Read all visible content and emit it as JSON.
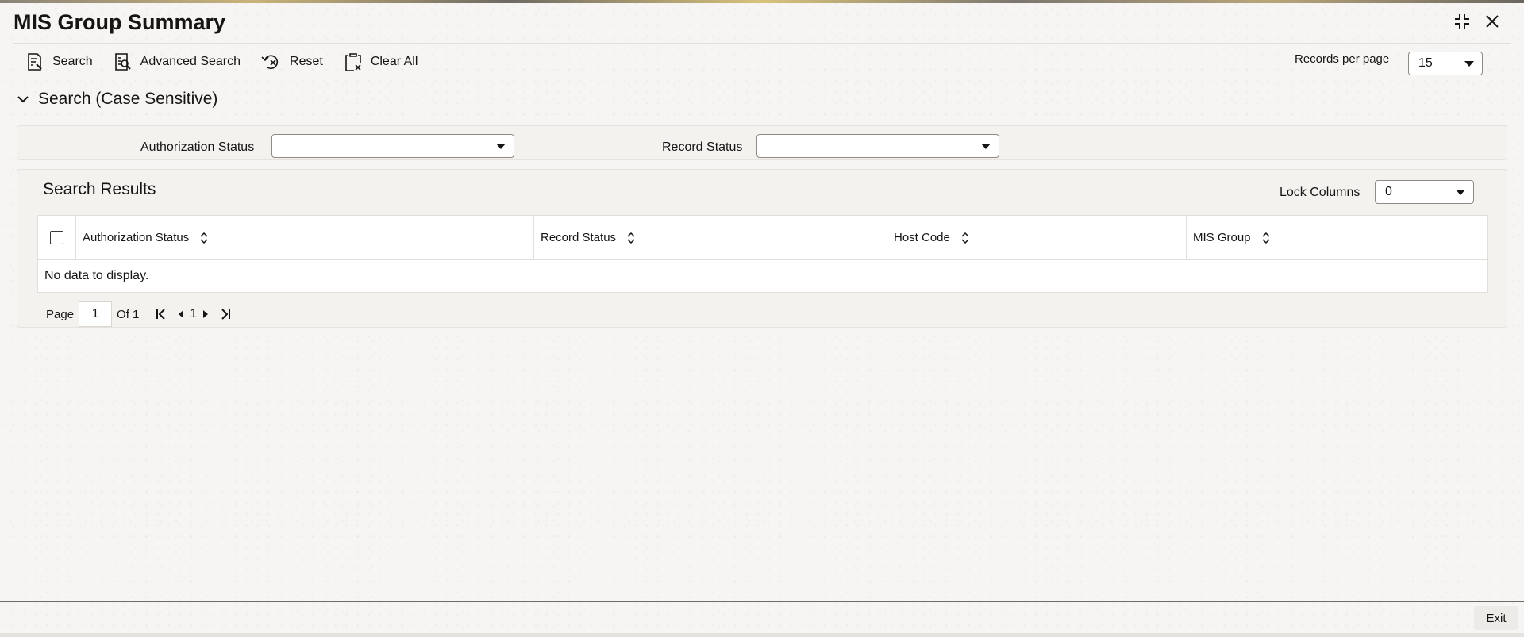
{
  "window": {
    "title": "MIS Group Summary"
  },
  "toolbar": {
    "search_label": "Search",
    "advanced_search_label": "Advanced Search",
    "reset_label": "Reset",
    "clear_all_label": "Clear All"
  },
  "records_per_page": {
    "label": "Records per page",
    "value": "15"
  },
  "search_section": {
    "title": "Search (Case Sensitive)",
    "authorization_status_label": "Authorization Status",
    "authorization_status_value": "",
    "record_status_label": "Record Status",
    "record_status_value": ""
  },
  "results": {
    "title": "Search Results",
    "lock_columns_label": "Lock Columns",
    "lock_columns_value": "0",
    "columns": [
      "Authorization Status",
      "Record Status",
      "Host Code",
      "MIS Group"
    ],
    "empty_message": "No data to display."
  },
  "pagination": {
    "page_label": "Page",
    "current_page": "1",
    "of_label": "Of 1",
    "page_number": "1"
  },
  "footer": {
    "exit_label": "Exit"
  }
}
